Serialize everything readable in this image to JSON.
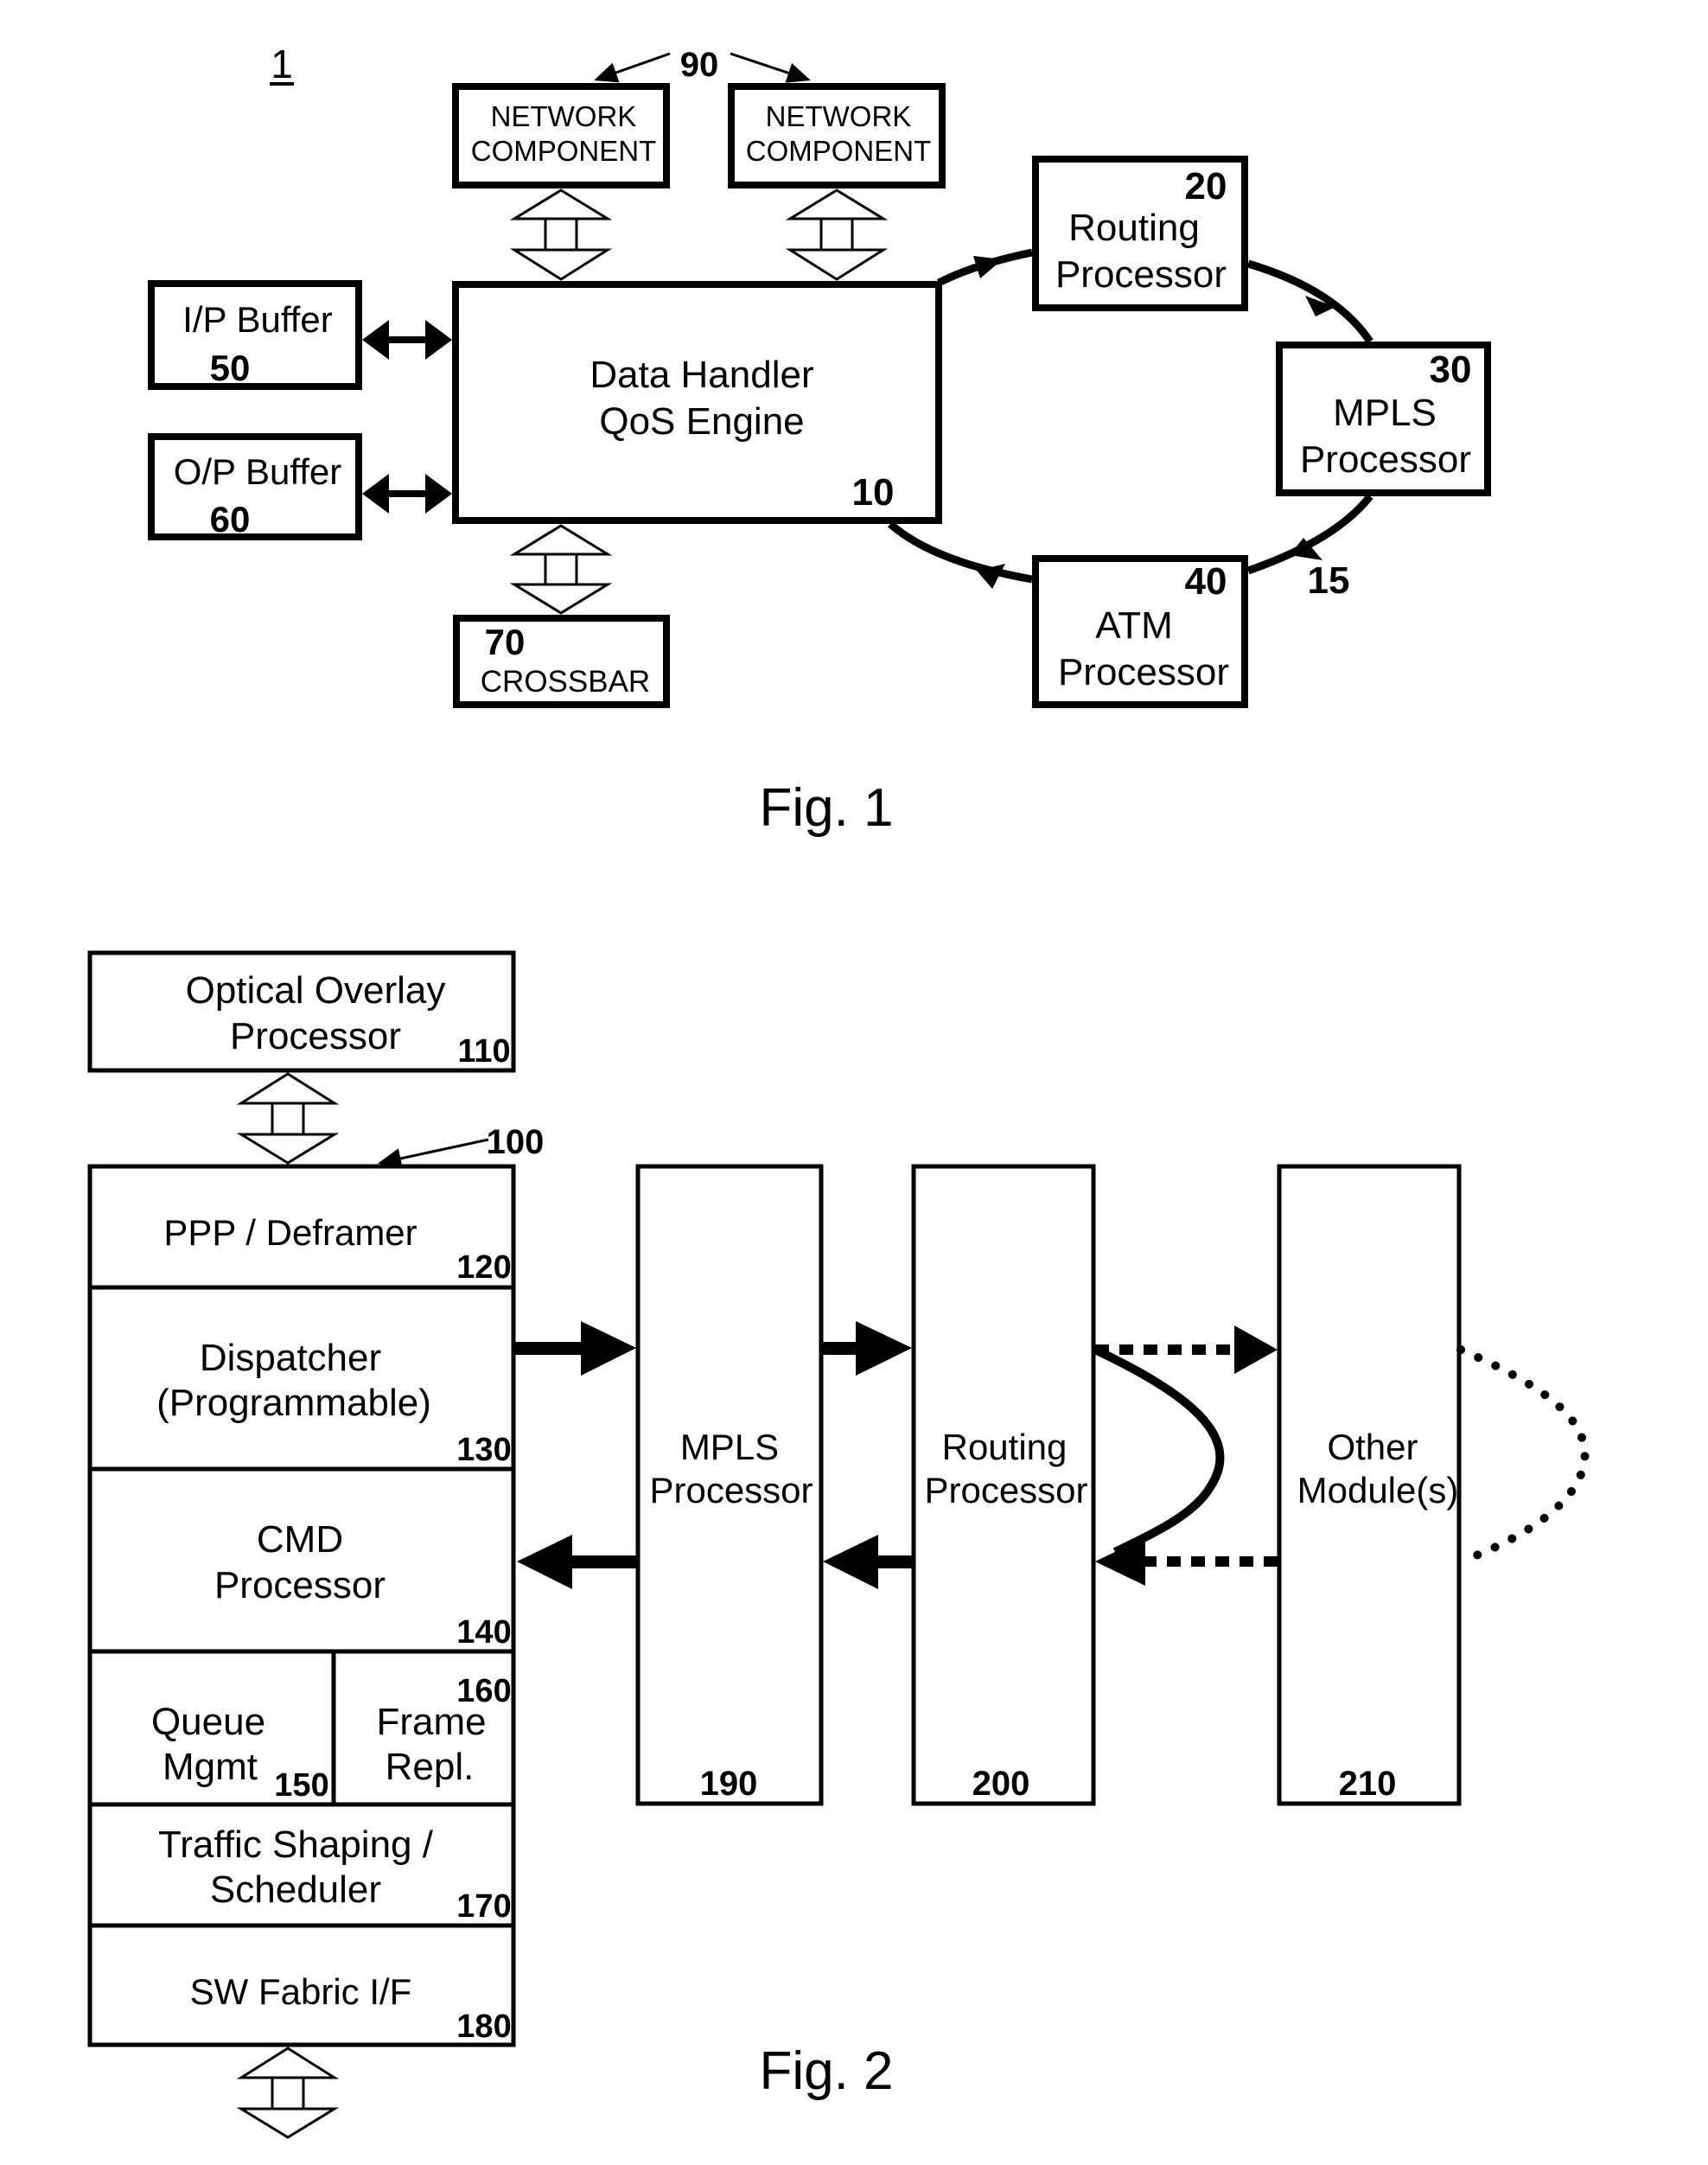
{
  "figure1": {
    "ref": "1",
    "caption": "Fig. 1",
    "network_ref": "90",
    "loop_ref": "15",
    "network_components": [
      {
        "line1": "NETWORK",
        "line2": "COMPONENT"
      },
      {
        "line1": "NETWORK",
        "line2": "COMPONENT"
      }
    ],
    "data_handler": {
      "line1": "Data Handler",
      "line2": "QoS Engine",
      "ref": "10"
    },
    "ip_buffer": {
      "label": "I/P Buffer",
      "ref": "50"
    },
    "op_buffer": {
      "label": "O/P Buffer",
      "ref": "60"
    },
    "crossbar": {
      "label": "CROSSBAR",
      "ref": "70"
    },
    "routing": {
      "line1": "Routing",
      "line2": "Processor",
      "ref": "20"
    },
    "mpls": {
      "line1": "MPLS",
      "line2": "Processor",
      "ref": "30"
    },
    "atm": {
      "line1": "ATM",
      "line2": "Processor",
      "ref": "40"
    }
  },
  "figure2": {
    "caption": "Fig. 2",
    "stack_ref": "100",
    "optical": {
      "line1": "Optical Overlay",
      "line2": "Processor",
      "ref": "110"
    },
    "stack": {
      "ppp": {
        "label": "PPP / Deframer",
        "ref": "120"
      },
      "dispatcher": {
        "line1": "Dispatcher",
        "line2": "(Programmable)",
        "ref": "130"
      },
      "cmd": {
        "line1": "CMD",
        "line2": "Processor",
        "ref": "140"
      },
      "queue": {
        "line1": "Queue",
        "line2": "Mgmt",
        "ref": "150"
      },
      "frame": {
        "line1": "Frame",
        "line2": "Repl.",
        "ref": "160"
      },
      "traffic": {
        "line1": "Traffic Shaping /",
        "line2": "Scheduler",
        "ref": "170"
      },
      "fabric": {
        "label": "SW Fabric I/F",
        "ref": "180"
      }
    },
    "mpls": {
      "line1": "MPLS",
      "line2": "Processor",
      "ref": "190"
    },
    "routing": {
      "line1": "Routing",
      "line2": "Processor",
      "ref": "200"
    },
    "other": {
      "line1": "Other",
      "line2": "Module(s)",
      "ref": "210"
    }
  }
}
